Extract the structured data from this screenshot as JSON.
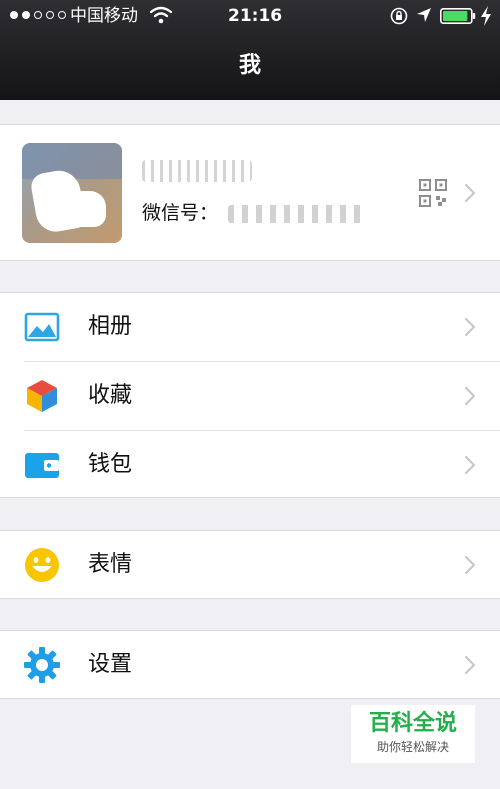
{
  "status_bar": {
    "carrier": "中国移动",
    "time": "21:16",
    "signal_bars_filled": 2,
    "signal_bars_total": 5,
    "battery_level": 0.9,
    "icons": [
      "signal-dots-icon",
      "wifi-icon",
      "rotation-lock-icon",
      "location-arrow-icon",
      "battery-icon",
      "charging-icon"
    ]
  },
  "nav": {
    "title": "我"
  },
  "profile": {
    "wechat_id_label": "微信号：",
    "icons": [
      "avatar",
      "qr-code-icon",
      "chevron-right-icon"
    ]
  },
  "menu": {
    "album": {
      "label": "相册",
      "icon": "album-icon"
    },
    "favorites": {
      "label": "收藏",
      "icon": "favorites-cube-icon"
    },
    "wallet": {
      "label": "钱包",
      "icon": "wallet-icon"
    },
    "stickers": {
      "label": "表情",
      "icon": "smiley-icon"
    },
    "settings": {
      "label": "设置",
      "icon": "gear-icon"
    }
  },
  "watermark": {
    "title": "百科全说",
    "subtitle": "助你轻松解决"
  },
  "colors": {
    "nav_background": "#1f1f22",
    "page_background": "#efeff4",
    "battery_green": "#4cd964",
    "album_blue": "#2ea7e0",
    "wallet_blue": "#1aa3e8",
    "smiley_yellow": "#f7c600",
    "gear_blue": "#1e9ee6",
    "chevron_gray": "#c7c7cc",
    "watermark_green": "#23b04a"
  }
}
